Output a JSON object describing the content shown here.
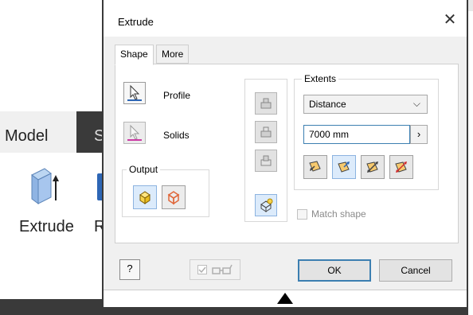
{
  "background": {
    "tab_label": "Model",
    "next_tab_label": "S",
    "extrude_label": "Extrude",
    "next_label": "R"
  },
  "dialog": {
    "title": "Extrude",
    "close_icon": "close-icon",
    "tabs": [
      {
        "label": "Shape",
        "active": true
      },
      {
        "label": "More",
        "active": false
      }
    ],
    "profile_label": "Profile",
    "solids_label": "Solids",
    "output_title": "Output",
    "extents_title": "Extents",
    "extents_type": "Distance",
    "distance_value": "7000 mm",
    "match_shape_label": "Match shape",
    "ok_label": "OK",
    "cancel_label": "Cancel",
    "help_label": "?"
  },
  "colors": {
    "accent_blue": "#2d66b5",
    "selection_blue": "#dcebfb",
    "solid_icon_yellow": "#f7d34a",
    "surface_icon_orange": "#e0673a",
    "dir_red": "#cf2b2b"
  }
}
